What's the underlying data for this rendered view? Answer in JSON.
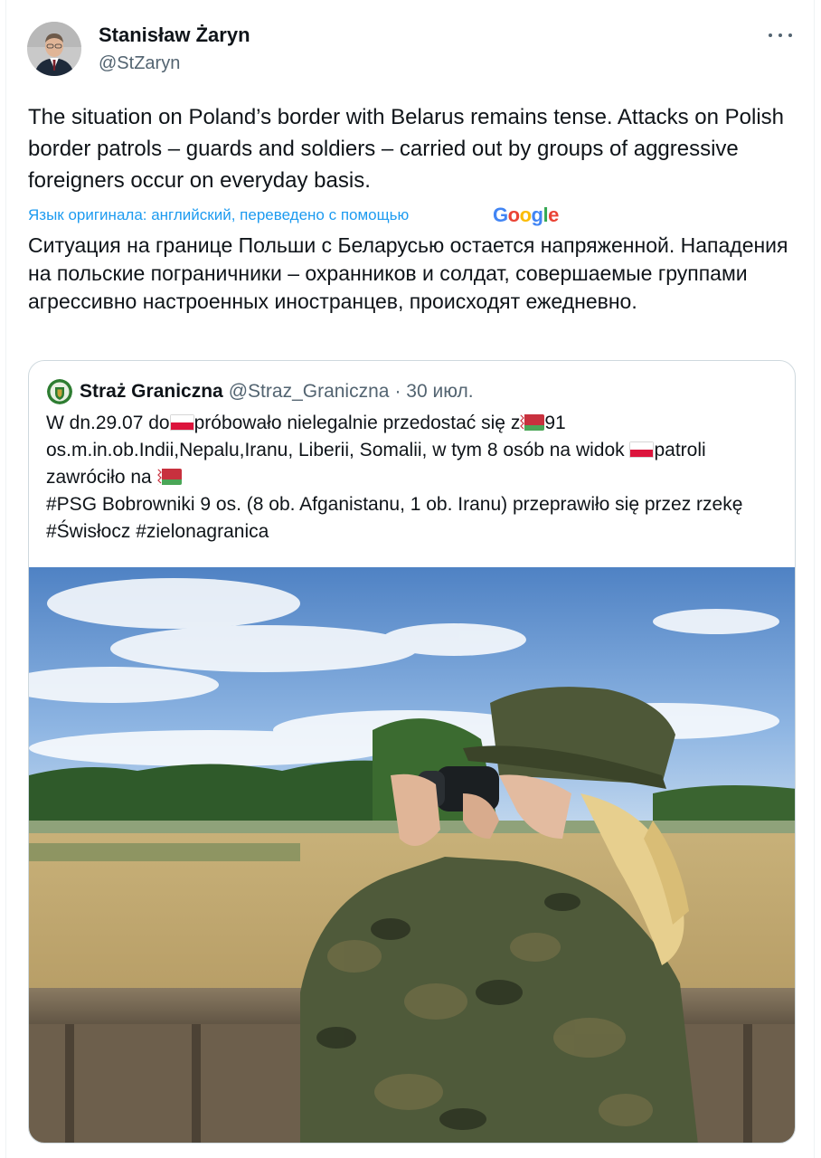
{
  "author": {
    "name": "Stanisław Żaryn",
    "handle": "@StZaryn"
  },
  "tweet": {
    "text": "The situation on Poland’s border with Belarus remains tense. Attacks on Polish border patrols – guards and soldiers –  carried out by groups of aggressive foreigners occur on everyday basis.",
    "translation_note": "Язык оригинала: английский, переведено с помощью",
    "translation_provider": "Google",
    "translated_text": "Ситуация на границе Польши с Беларусью остается напряженной. Нападения на польские пограничники – охранников и солдат, совершаемые группами агрессивно настроенных иностранцев, происходят ежедневно."
  },
  "quoted": {
    "name": "Straż Graniczna",
    "handle": "@Straz_Graniczna",
    "date": "· 30 июл.",
    "text_parts": [
      "W dn.29.07 do",
      "próbowało nielegalnie przedostać się z",
      "91 os.m.in.ob.Indii,Nepalu,Iranu, Liberii, Somalii, w tym 8 osób na widok ",
      "patroli zawróciło na ",
      "#PSG Bobrowniki 9 os. (8 ob. Afganistanu, 1 ob. Iranu) przeprawiło się przez rzekę #Świsłocz #zielonagranica"
    ],
    "flags": [
      "flag-poland-icon",
      "flag-belarus-icon",
      "flag-poland-icon",
      "flag-belarus-icon"
    ]
  },
  "icons": {
    "more": "more-horizontal-icon",
    "avatar": "profile-photo",
    "quoted_avatar": "border-guard-emblem-icon"
  },
  "colors": {
    "link": "#1d9bf0",
    "secondary_text": "#536471",
    "border": "#cfd9de",
    "poland_red": "#dc143c",
    "belarus_red": "#c8313e",
    "belarus_green": "#4aa657"
  }
}
